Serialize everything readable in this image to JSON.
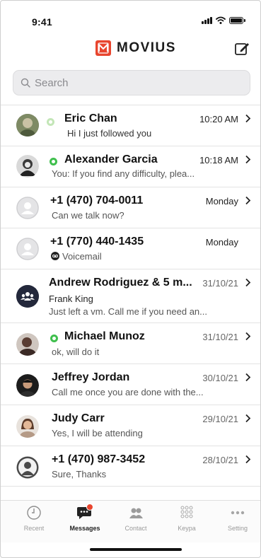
{
  "status": {
    "time": "9:41"
  },
  "header": {
    "brand": "MOVIUS"
  },
  "search": {
    "placeholder": "Search"
  },
  "conversations": [
    {
      "name": "Eric Chan",
      "preview": "Hi I just followed you",
      "when": "10:20 AM"
    },
    {
      "name": "Alexander Garcia",
      "preview": "You: If you find any difficulty, plea...",
      "when": "10:18 AM"
    },
    {
      "name": "+1 (470) 704-0011",
      "preview": "Can we talk now?",
      "when": "Monday"
    },
    {
      "name": "+1 (770) 440-1435",
      "preview": "Voicemail",
      "when": "Monday"
    },
    {
      "name": "Andrew Rodriguez & 5 m...",
      "sender": "Frank King",
      "preview": "Just left a vm. Call me if you need an...",
      "when": "31/10/21"
    },
    {
      "name": "Michael Munoz",
      "preview": "ok, will do it",
      "when": "31/10/21"
    },
    {
      "name": "Jeffrey Jordan",
      "preview": "Call me once you are done with the...",
      "when": "30/10/21"
    },
    {
      "name": "Judy Carr",
      "preview": "Yes, I will be attending",
      "when": "29/10/21"
    },
    {
      "name": "+1 (470) 987-3452",
      "preview": "Sure, Thanks",
      "when": "28/10/21"
    }
  ],
  "tabs": [
    {
      "label": "Recent"
    },
    {
      "label": "Messages"
    },
    {
      "label": "Contact"
    },
    {
      "label": "Keypa"
    },
    {
      "label": "Setting"
    }
  ],
  "colors": {
    "brand": "#e8452e",
    "whatsapp": "#3fbf4d"
  },
  "icons": [
    "search-icon",
    "compose-icon",
    "chevron-right-icon",
    "whatsapp-icon",
    "voicemail-icon",
    "clock-icon",
    "chat-icon",
    "contacts-icon",
    "keypad-icon",
    "more-icon"
  ]
}
